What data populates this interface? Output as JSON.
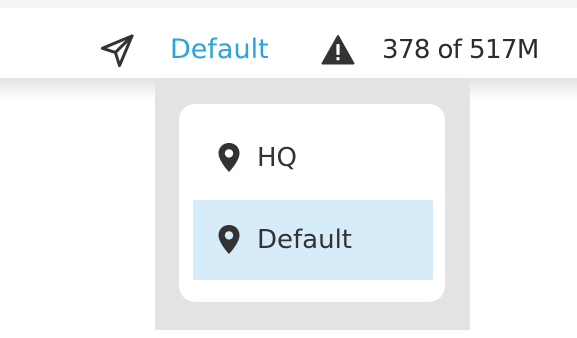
{
  "toolbar": {
    "send_icon": "send-icon",
    "location_selected": "Default",
    "warning_icon": "warning-triangle-icon",
    "usage_text": "378 of 517M"
  },
  "dropdown": {
    "items": [
      {
        "label": "HQ",
        "icon": "map-pin-icon",
        "selected": false
      },
      {
        "label": "Default",
        "icon": "map-pin-icon",
        "selected": true
      }
    ]
  },
  "colors": {
    "accent": "#2ca3dc",
    "selected_bg": "#d7ecf9",
    "icon": "#333333",
    "backdrop": "#e3e3e3"
  }
}
